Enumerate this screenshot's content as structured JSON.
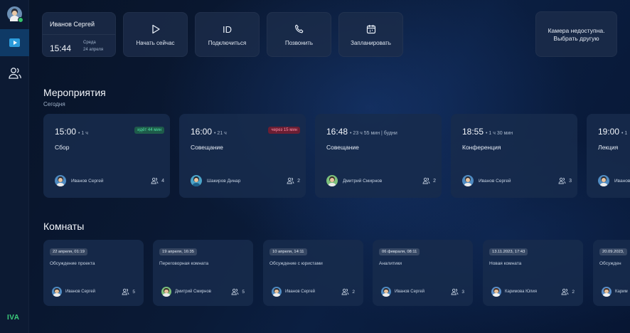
{
  "colors": {
    "accent": "#2d9cdb",
    "online": "#35c46a",
    "badge_now_bg": "#1e5b4a",
    "badge_now_fg": "#4fe2a3",
    "badge_soon_bg": "#6b1e33",
    "badge_soon_fg": "#ff8fa6",
    "logo": "#3ccf7c"
  },
  "sidebar": {
    "items": [
      {
        "icon": "user-avatar-icon",
        "status": "online"
      },
      {
        "icon": "video-play-icon",
        "active": true
      },
      {
        "icon": "people-icon"
      }
    ],
    "logo": "IVA"
  },
  "header": {
    "user_name": "Иванов Сергей",
    "time": "15:44",
    "weekday": "Среда",
    "date": "24 апреля",
    "actions": [
      {
        "label": "Начать сейчас",
        "icon": "play-icon"
      },
      {
        "label": "Подключиться",
        "icon": "id-icon"
      },
      {
        "label": "Позвонить",
        "icon": "phone-icon"
      },
      {
        "label": "Запланировать",
        "icon": "calendar-icon"
      }
    ],
    "camera_line1": "Камера недоступна.",
    "camera_line2": "Выбрать другую"
  },
  "events": {
    "title": "Мероприятия",
    "subtitle": "Сегодня",
    "items": [
      {
        "time": "15:00",
        "dur": "• 1 ч",
        "badge": "идёт 44 мин",
        "badge_type": "now",
        "title": "Сбор",
        "owner": "Иванов Сергей",
        "count": "4",
        "avatar": "a"
      },
      {
        "time": "16:00",
        "dur": "• 21 ч",
        "badge": "через 15 мин",
        "badge_type": "soon",
        "title": "Совещание",
        "owner": "Шакиров Динар",
        "count": "2",
        "avatar": "b"
      },
      {
        "time": "16:48",
        "dur": "• 23 ч 55 мин  |  будни",
        "badge": "",
        "badge_type": "",
        "title": "Совещание",
        "owner": "Дмитрий Смирнов",
        "count": "2",
        "avatar": "c"
      },
      {
        "time": "18:55",
        "dur": "• 1 ч 30 мин",
        "badge": "",
        "badge_type": "",
        "title": "Конференция",
        "owner": "Иванов Сергей",
        "count": "3",
        "avatar": "a"
      },
      {
        "time": "19:00",
        "dur": "• 1",
        "badge": "",
        "badge_type": "",
        "title": "Лекция",
        "owner": "Иванов",
        "count": "",
        "avatar": "a"
      }
    ]
  },
  "rooms": {
    "title": "Комнаты",
    "items": [
      {
        "stamp": "22 апреля, 01:19",
        "title": "Обсуждение проекта",
        "owner": "Иванов Сергей",
        "count": "5",
        "avatar": "a"
      },
      {
        "stamp": "19 апреля, 16:35",
        "title": "Переговорная комната",
        "owner": "Дмитрий Смирнов",
        "count": "5",
        "avatar": "c"
      },
      {
        "stamp": "10 апреля, 14:11",
        "title": "Обсуждение с юристами",
        "owner": "Иванов Сергей",
        "count": "2",
        "avatar": "a"
      },
      {
        "stamp": "06 февраля, 08:11",
        "title": "Аналитики",
        "owner": "Иванов Сергей",
        "count": "3",
        "avatar": "a"
      },
      {
        "stamp": "13.11.2023, 17:43",
        "title": "Новая комната",
        "owner": "Каримова Юлия",
        "count": "2",
        "avatar": "d"
      },
      {
        "stamp": "20.09.2023,",
        "title": "Обсужден",
        "owner": "Карим",
        "count": "",
        "avatar": "d"
      }
    ]
  }
}
